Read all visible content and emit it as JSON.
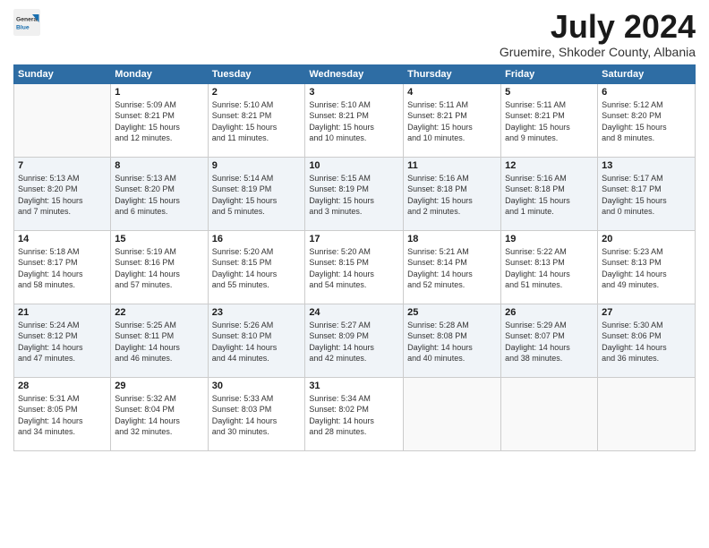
{
  "logo": {
    "general": "General",
    "blue": "Blue"
  },
  "title": "July 2024",
  "subtitle": "Gruemire, Shkoder County, Albania",
  "days_header": [
    "Sunday",
    "Monday",
    "Tuesday",
    "Wednesday",
    "Thursday",
    "Friday",
    "Saturday"
  ],
  "weeks": [
    [
      {
        "num": "",
        "info": ""
      },
      {
        "num": "1",
        "info": "Sunrise: 5:09 AM\nSunset: 8:21 PM\nDaylight: 15 hours\nand 12 minutes."
      },
      {
        "num": "2",
        "info": "Sunrise: 5:10 AM\nSunset: 8:21 PM\nDaylight: 15 hours\nand 11 minutes."
      },
      {
        "num": "3",
        "info": "Sunrise: 5:10 AM\nSunset: 8:21 PM\nDaylight: 15 hours\nand 10 minutes."
      },
      {
        "num": "4",
        "info": "Sunrise: 5:11 AM\nSunset: 8:21 PM\nDaylight: 15 hours\nand 10 minutes."
      },
      {
        "num": "5",
        "info": "Sunrise: 5:11 AM\nSunset: 8:21 PM\nDaylight: 15 hours\nand 9 minutes."
      },
      {
        "num": "6",
        "info": "Sunrise: 5:12 AM\nSunset: 8:20 PM\nDaylight: 15 hours\nand 8 minutes."
      }
    ],
    [
      {
        "num": "7",
        "info": "Sunrise: 5:13 AM\nSunset: 8:20 PM\nDaylight: 15 hours\nand 7 minutes."
      },
      {
        "num": "8",
        "info": "Sunrise: 5:13 AM\nSunset: 8:20 PM\nDaylight: 15 hours\nand 6 minutes."
      },
      {
        "num": "9",
        "info": "Sunrise: 5:14 AM\nSunset: 8:19 PM\nDaylight: 15 hours\nand 5 minutes."
      },
      {
        "num": "10",
        "info": "Sunrise: 5:15 AM\nSunset: 8:19 PM\nDaylight: 15 hours\nand 3 minutes."
      },
      {
        "num": "11",
        "info": "Sunrise: 5:16 AM\nSunset: 8:18 PM\nDaylight: 15 hours\nand 2 minutes."
      },
      {
        "num": "12",
        "info": "Sunrise: 5:16 AM\nSunset: 8:18 PM\nDaylight: 15 hours\nand 1 minute."
      },
      {
        "num": "13",
        "info": "Sunrise: 5:17 AM\nSunset: 8:17 PM\nDaylight: 15 hours\nand 0 minutes."
      }
    ],
    [
      {
        "num": "14",
        "info": "Sunrise: 5:18 AM\nSunset: 8:17 PM\nDaylight: 14 hours\nand 58 minutes."
      },
      {
        "num": "15",
        "info": "Sunrise: 5:19 AM\nSunset: 8:16 PM\nDaylight: 14 hours\nand 57 minutes."
      },
      {
        "num": "16",
        "info": "Sunrise: 5:20 AM\nSunset: 8:15 PM\nDaylight: 14 hours\nand 55 minutes."
      },
      {
        "num": "17",
        "info": "Sunrise: 5:20 AM\nSunset: 8:15 PM\nDaylight: 14 hours\nand 54 minutes."
      },
      {
        "num": "18",
        "info": "Sunrise: 5:21 AM\nSunset: 8:14 PM\nDaylight: 14 hours\nand 52 minutes."
      },
      {
        "num": "19",
        "info": "Sunrise: 5:22 AM\nSunset: 8:13 PM\nDaylight: 14 hours\nand 51 minutes."
      },
      {
        "num": "20",
        "info": "Sunrise: 5:23 AM\nSunset: 8:13 PM\nDaylight: 14 hours\nand 49 minutes."
      }
    ],
    [
      {
        "num": "21",
        "info": "Sunrise: 5:24 AM\nSunset: 8:12 PM\nDaylight: 14 hours\nand 47 minutes."
      },
      {
        "num": "22",
        "info": "Sunrise: 5:25 AM\nSunset: 8:11 PM\nDaylight: 14 hours\nand 46 minutes."
      },
      {
        "num": "23",
        "info": "Sunrise: 5:26 AM\nSunset: 8:10 PM\nDaylight: 14 hours\nand 44 minutes."
      },
      {
        "num": "24",
        "info": "Sunrise: 5:27 AM\nSunset: 8:09 PM\nDaylight: 14 hours\nand 42 minutes."
      },
      {
        "num": "25",
        "info": "Sunrise: 5:28 AM\nSunset: 8:08 PM\nDaylight: 14 hours\nand 40 minutes."
      },
      {
        "num": "26",
        "info": "Sunrise: 5:29 AM\nSunset: 8:07 PM\nDaylight: 14 hours\nand 38 minutes."
      },
      {
        "num": "27",
        "info": "Sunrise: 5:30 AM\nSunset: 8:06 PM\nDaylight: 14 hours\nand 36 minutes."
      }
    ],
    [
      {
        "num": "28",
        "info": "Sunrise: 5:31 AM\nSunset: 8:05 PM\nDaylight: 14 hours\nand 34 minutes."
      },
      {
        "num": "29",
        "info": "Sunrise: 5:32 AM\nSunset: 8:04 PM\nDaylight: 14 hours\nand 32 minutes."
      },
      {
        "num": "30",
        "info": "Sunrise: 5:33 AM\nSunset: 8:03 PM\nDaylight: 14 hours\nand 30 minutes."
      },
      {
        "num": "31",
        "info": "Sunrise: 5:34 AM\nSunset: 8:02 PM\nDaylight: 14 hours\nand 28 minutes."
      },
      {
        "num": "",
        "info": ""
      },
      {
        "num": "",
        "info": ""
      },
      {
        "num": "",
        "info": ""
      }
    ]
  ]
}
